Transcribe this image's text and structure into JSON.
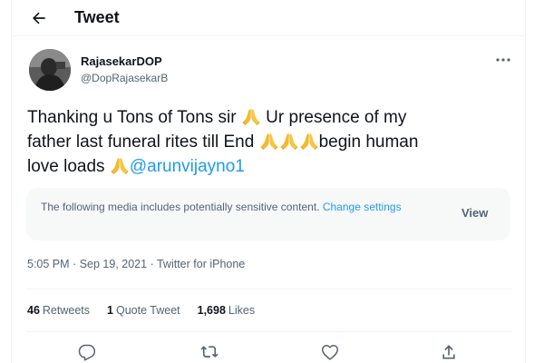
{
  "header": {
    "title": "Tweet"
  },
  "user": {
    "display_name": "RajasekarDOP",
    "handle": "@DopRajasekarB"
  },
  "tweet": {
    "line1_a": "Thanking u Tons of Tons sir",
    "line1_b": " Ur presence of my",
    "line2_a": "father last funeral rites till End",
    "line2_b": "begin human",
    "line3_a": "love loads",
    "mention": "@arunvijayno1"
  },
  "sensitive": {
    "message": "The following media includes potentially sensitive content. ",
    "link": "Change settings",
    "view_label": "View"
  },
  "meta": {
    "time": "5:05 PM",
    "date": "Sep 19, 2021",
    "sep": "·",
    "source": "Twitter for iPhone"
  },
  "stats": {
    "retweets_count": "46",
    "retweets_label": "Retweets",
    "quotes_count": "1",
    "quotes_label": "Quote Tweet",
    "likes_count": "1,698",
    "likes_label": "Likes"
  },
  "icons": {
    "back": "arrow-left-icon",
    "more": "more-horizontal-icon",
    "emoji": "folded-hands-emoji",
    "reply": "reply-icon",
    "retweet": "retweet-icon",
    "like": "heart-icon",
    "share": "share-icon"
  },
  "colors": {
    "accent": "#1d9bf0",
    "text": "#0f1419",
    "muted": "#536471",
    "emoji": "#f5b82e"
  }
}
